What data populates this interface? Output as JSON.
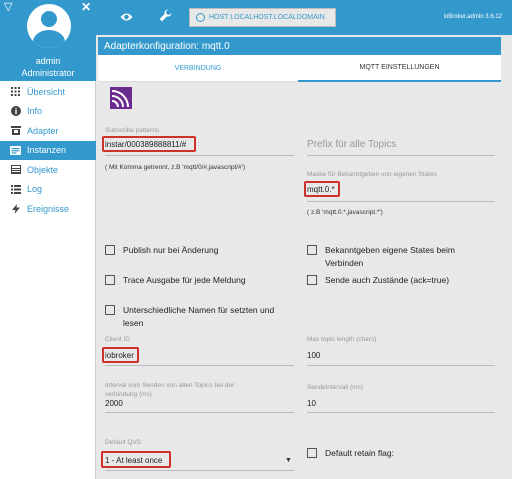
{
  "sidebar": {
    "user_name": "admin",
    "user_role": "Administrator",
    "items": [
      {
        "label": "Übersicht",
        "icon": "grid-icon"
      },
      {
        "label": "Info",
        "icon": "info-icon"
      },
      {
        "label": "Adapter",
        "icon": "store-icon"
      },
      {
        "label": "Instanzen",
        "icon": "instances-icon",
        "active": true
      },
      {
        "label": "Objekte",
        "icon": "objects-icon"
      },
      {
        "label": "Log",
        "icon": "list-icon"
      },
      {
        "label": "Ereignisse",
        "icon": "bolt-icon"
      }
    ]
  },
  "topbar": {
    "host_label": "HOST LOCALHOST.LOCALDOMAIN",
    "version": "ioBroker.admin 3.6.12"
  },
  "page": {
    "title": "Adapterkonfiguration: mqtt.0",
    "tabs": [
      "VERBINDUNG",
      "MQTT EINSTELLUNGEN"
    ],
    "active_tab": 1
  },
  "form": {
    "subscribe_label": "Subscribe patterns",
    "subscribe_value": "instar/000389888811/#",
    "subscribe_hint": "( Mit Komma getrennt, z.B 'mqtt/0/#,javascript/#')",
    "prefix_label": "Prefix für alle Topics",
    "mask_label": "Maske für Bekanntgeben von eigenen States",
    "mask_value": "mqtt.0.*",
    "mask_hint": "( z.B 'mqtt.0.*,javascript.*')",
    "checkboxes": [
      "Publish nur bei Änderung",
      "Bekanntgeben eigene States beim Verbinden",
      "Trace Ausgabe für jede Meldung",
      "Sende auch Zustände (ack=true)",
      "Unterschiedliche Namen für setzten und lesen"
    ],
    "client_id_label": "Client ID",
    "client_id_value": "iobroker",
    "max_topic_label": "Max topic length (chars)",
    "max_topic_value": "100",
    "interval_label": "Interval vom Senden von allen Topics bei der verbindung (ms)",
    "interval_value": "2000",
    "send_interval_label": "Sendeintervall (ms)",
    "send_interval_value": "10",
    "qos_label": "Default QoS:",
    "qos_value": "1 - At least once",
    "retain_label": "Default retain flag:"
  }
}
